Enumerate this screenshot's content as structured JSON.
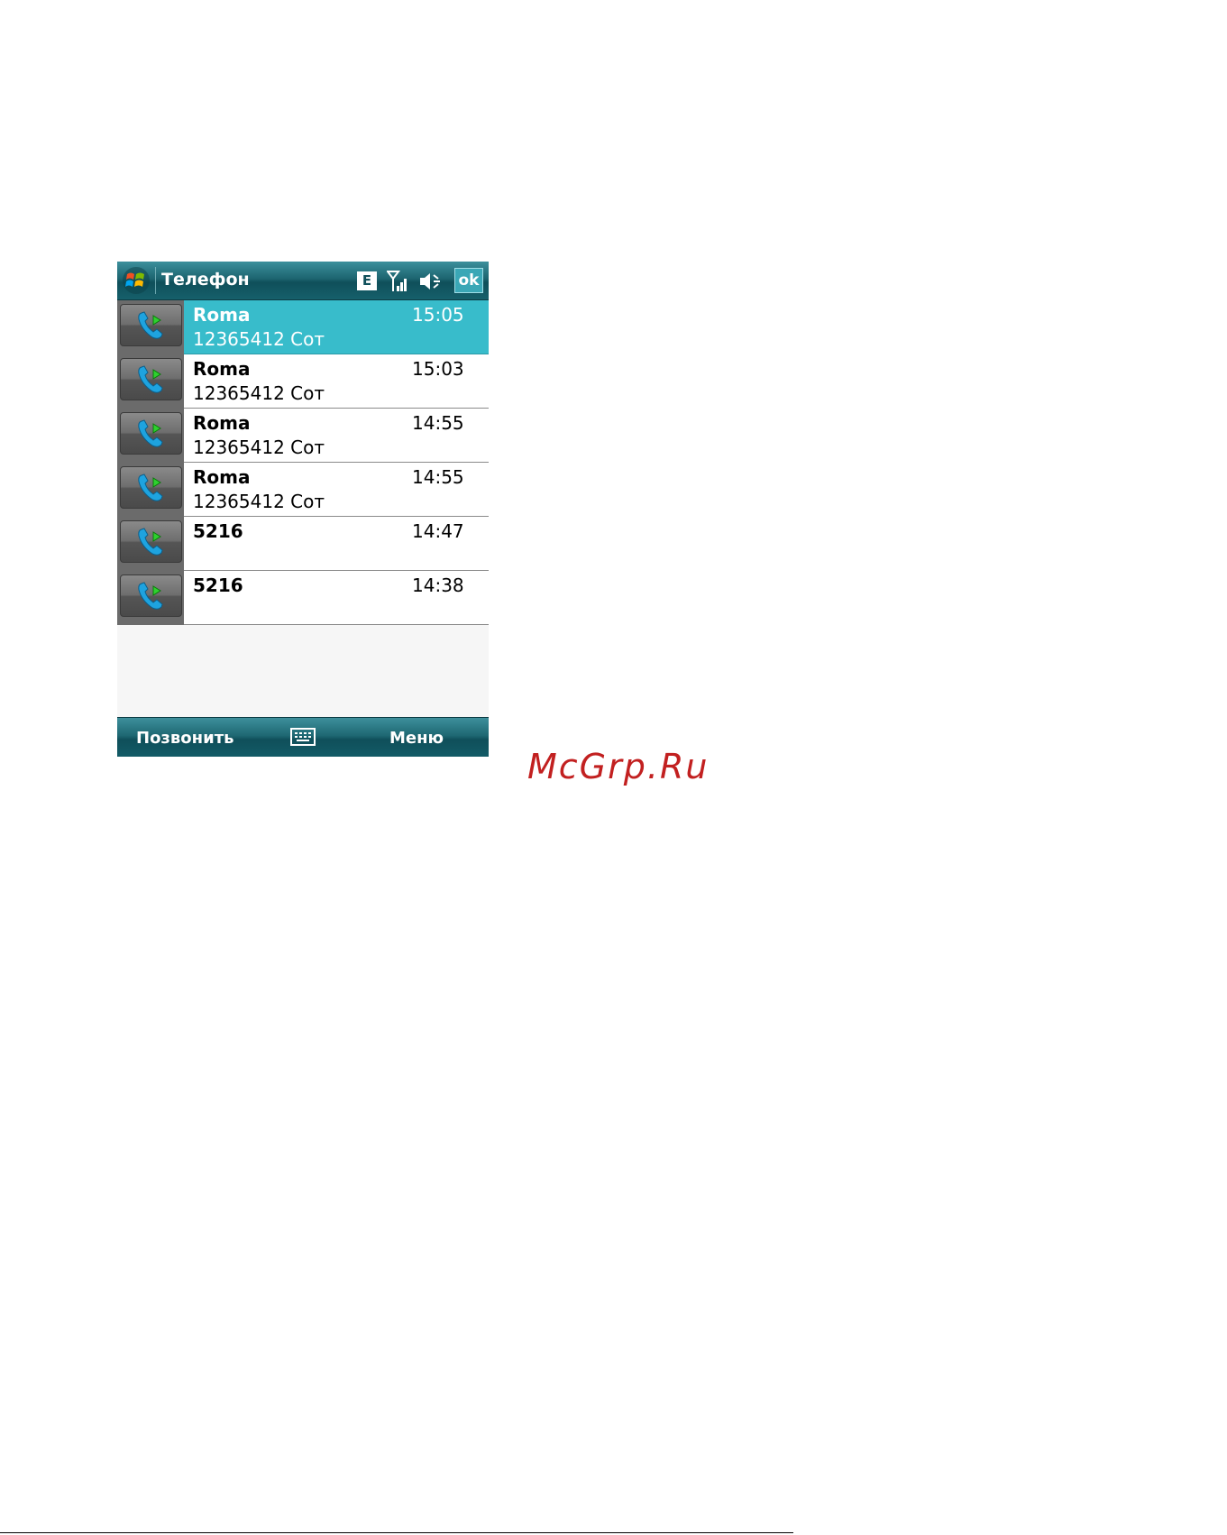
{
  "window": {
    "title": "Телефон",
    "network_badge": "E",
    "ok_label": "ok",
    "icons": [
      "windows-start-icon",
      "signal-icon",
      "speaker-icon"
    ]
  },
  "calls": [
    {
      "name": "Roma",
      "time": "15:05",
      "number": "12365412 Сот",
      "selected": true
    },
    {
      "name": "Roma",
      "time": "15:03",
      "number": "12365412 Сот",
      "selected": false
    },
    {
      "name": "Roma",
      "time": "14:55",
      "number": "12365412 Сот",
      "selected": false
    },
    {
      "name": "Roma",
      "time": "14:55",
      "number": "12365412 Сот",
      "selected": false
    },
    {
      "name": "5216",
      "time": "14:47",
      "number": "",
      "selected": false
    },
    {
      "name": "5216",
      "time": "14:38",
      "number": "",
      "selected": false
    }
  ],
  "softkeys": {
    "left": "Позвонить",
    "right": "Меню",
    "center_icon": "keyboard-icon"
  },
  "watermark": "McGrp.Ru",
  "colors": {
    "title_bar": "#1d6570",
    "selected_row": "#38bccb",
    "watermark": "#c22020"
  }
}
